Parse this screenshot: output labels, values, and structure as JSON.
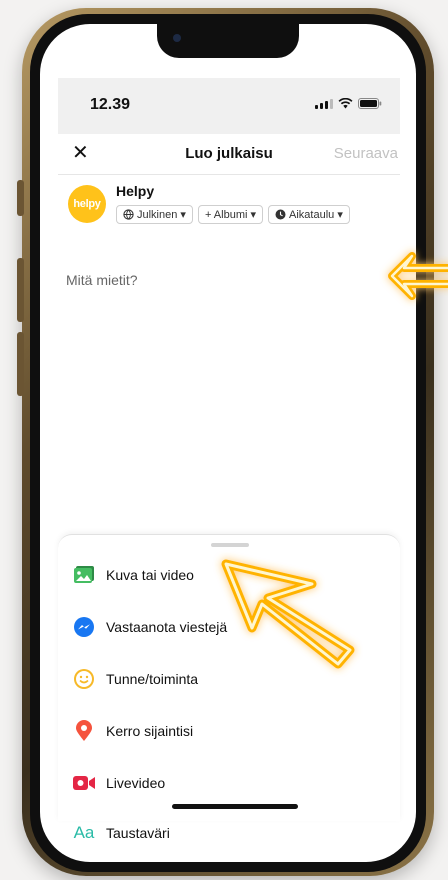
{
  "status": {
    "time": "12.39"
  },
  "nav": {
    "close": "✕",
    "title": "Luo julkaisu",
    "next": "Seuraava"
  },
  "author": {
    "name": "Helpy",
    "avatar_text": "helpy",
    "pills": [
      "Julkinen ▾",
      "+ Albumi ▾",
      "Aikataulu ▾"
    ]
  },
  "composer": {
    "placeholder": "Mitä mietit?"
  },
  "options": [
    {
      "label": "Kuva tai video",
      "icon": "photo-icon"
    },
    {
      "label": "Vastaanota viestejä",
      "icon": "messenger-icon"
    },
    {
      "label": "Tunne/toiminta",
      "icon": "smiley-icon"
    },
    {
      "label": "Kerro sijaintisi",
      "icon": "location-pin-icon"
    },
    {
      "label": "Livevideo",
      "icon": "live-video-icon"
    },
    {
      "label": "Taustaväri",
      "icon": "text-aa-icon"
    }
  ],
  "colors": {
    "avatar": "#ffc21a",
    "accent_glow": "#ffb300",
    "photo_green": "#45bd62",
    "messenger_blue": "#1877f2",
    "smiley_yellow": "#f7b928",
    "pin_red": "#f5533d",
    "live_red": "#e42645",
    "aa_teal": "#2abba7"
  }
}
